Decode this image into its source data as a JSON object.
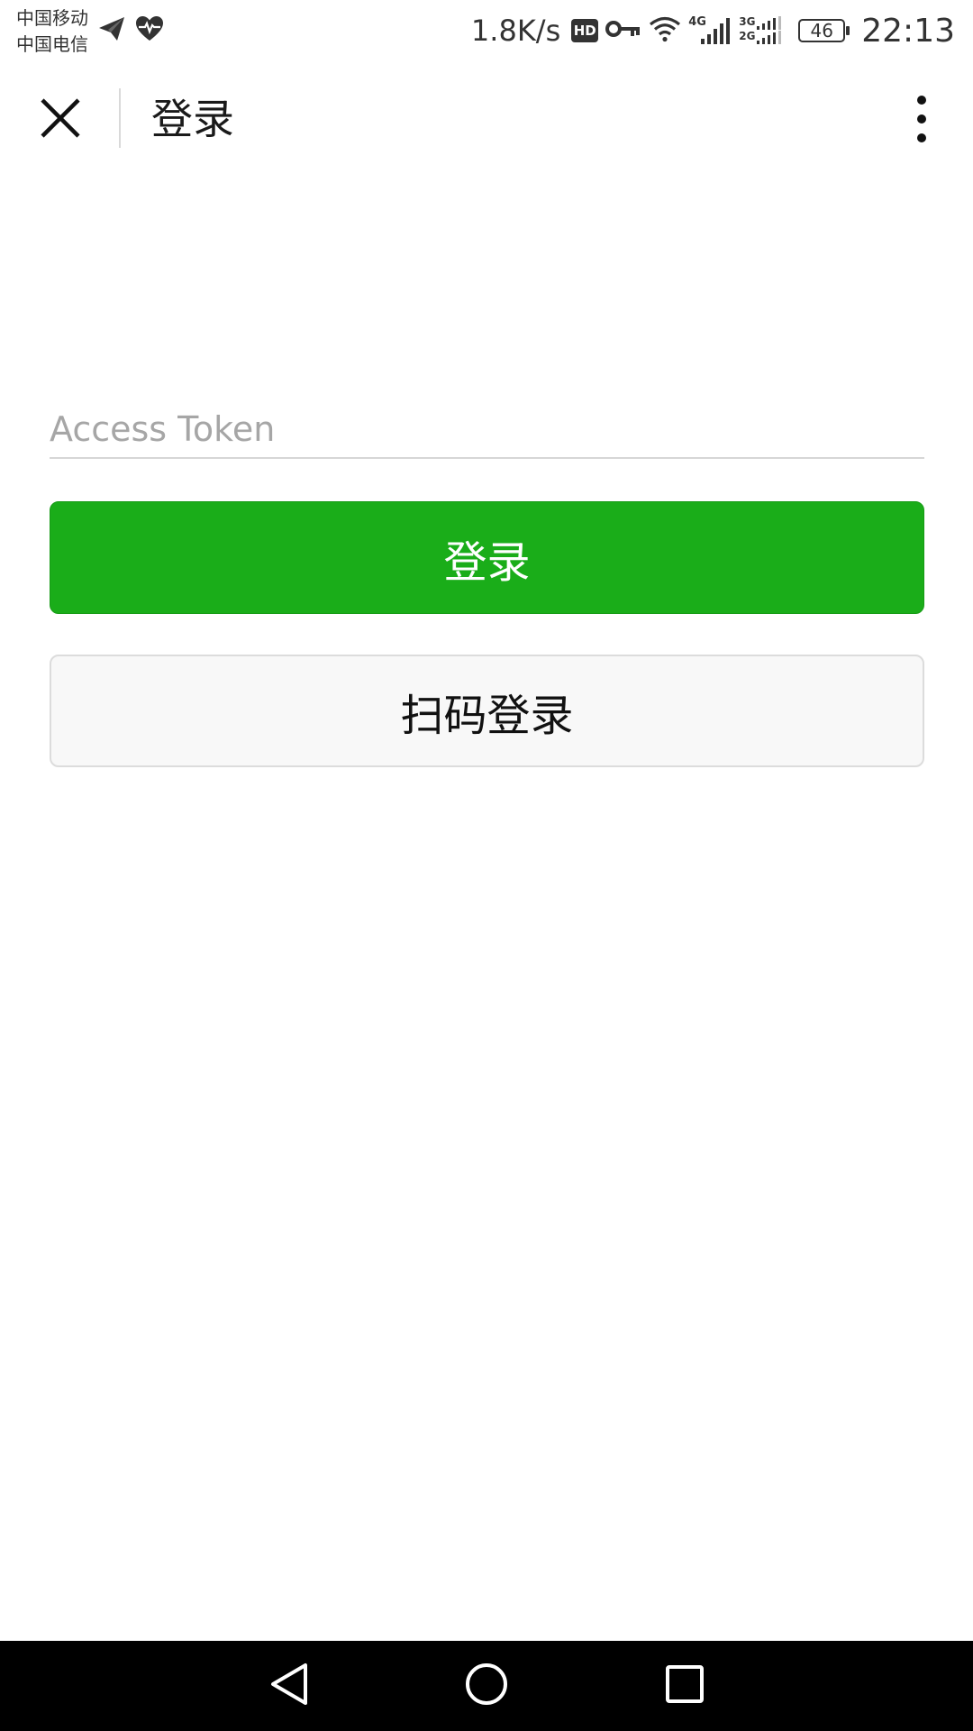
{
  "status_bar": {
    "carrier_1": "中国移动",
    "carrier_2": "中国电信",
    "left_icons": [
      "paper-plane-icon",
      "heart-pulse-icon"
    ],
    "net_speed": "1.8K/s",
    "hd_badge": "HD",
    "right_icons": [
      "key-icon",
      "wifi-icon",
      "signal-4g-icon",
      "signal-3g-2g-icon"
    ],
    "network_4g": "4G",
    "network_3g": "3G",
    "network_2g": "2G",
    "battery_level": "46",
    "time": "22:13"
  },
  "title_bar": {
    "close_icon": "close-icon",
    "title": "登录",
    "more_icon": "more-vertical-icon"
  },
  "form": {
    "token_placeholder": "Access Token",
    "token_value": "",
    "login_label": "登录",
    "scan_login_label": "扫码登录"
  },
  "colors": {
    "primary_green": "#1aad19",
    "secondary_button_bg": "#f8f8f8",
    "placeholder": "#a6a6a6",
    "nav_bar": "#000000"
  },
  "nav_bar": {
    "items": [
      "back-icon",
      "home-icon",
      "recents-icon"
    ]
  }
}
